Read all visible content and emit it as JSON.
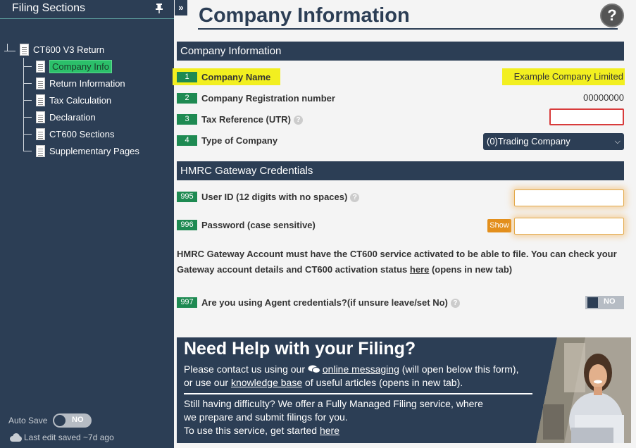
{
  "sidebar": {
    "title": "Filing Sections",
    "collapse_label": "»",
    "root": {
      "label": "CT600 V3 Return"
    },
    "items": [
      {
        "label": "Company Info",
        "active": true
      },
      {
        "label": "Return Information"
      },
      {
        "label": "Tax Calculation"
      },
      {
        "label": "Declaration"
      },
      {
        "label": "CT600 Sections"
      },
      {
        "label": "Supplementary Pages"
      }
    ],
    "autosave_label": "Auto Save",
    "autosave_state": "NO",
    "last_saved": "Last edit saved ~7d ago"
  },
  "page": {
    "title": "Company Information",
    "help_glyph": "?"
  },
  "company_section": {
    "header": "Company Information",
    "fields": [
      {
        "num": "1",
        "label": "Company Name",
        "value": "Example Company Limited"
      },
      {
        "num": "2",
        "label": "Company Registration number",
        "value": "00000000"
      },
      {
        "num": "3",
        "label": "Tax Reference (UTR)",
        "value": ""
      },
      {
        "num": "4",
        "label": "Type of Company",
        "value": "(0)Trading Company"
      }
    ]
  },
  "gateway_section": {
    "header": "HMRC Gateway Credentials",
    "user_id": {
      "num": "995",
      "label": "User ID (12 digits with no spaces)",
      "value": ""
    },
    "password": {
      "num": "996",
      "label": "Password (case sensitive)",
      "value": "",
      "show_label": "Show"
    },
    "note_before_link": "HMRC Gateway Account must have the CT600 service activated to be able to file. You can check your Gateway account details and CT600 activation status ",
    "note_link": "here",
    "note_after_link": " (opens in new tab)",
    "agent": {
      "num": "997",
      "label": "Are you using Agent credentials?(if unsure leave/set No)",
      "state": "NO"
    }
  },
  "help_banner": {
    "heading": "Need Help with your Filing?",
    "line1_before": "Please contact us using our ",
    "line1_link": "online messaging",
    "line1_after": " (will open below this form),",
    "line2_before": "or use our ",
    "line2_link": "knowledge base",
    "line2_after": " of useful articles (opens in new tab).",
    "line3": "Still having difficulty? We offer a Fully Managed Filing service, where",
    "line4": "we prepare and submit filings for you.",
    "line5_before": "To use this service, get started ",
    "line5_link": "here"
  },
  "colors": {
    "navy": "#2c3e55",
    "badge_green": "#1e8a52",
    "active_green": "#2bc06a",
    "highlight_yellow": "#f2ef20",
    "error_red": "#d83b3b",
    "show_orange": "#e38f1c"
  }
}
